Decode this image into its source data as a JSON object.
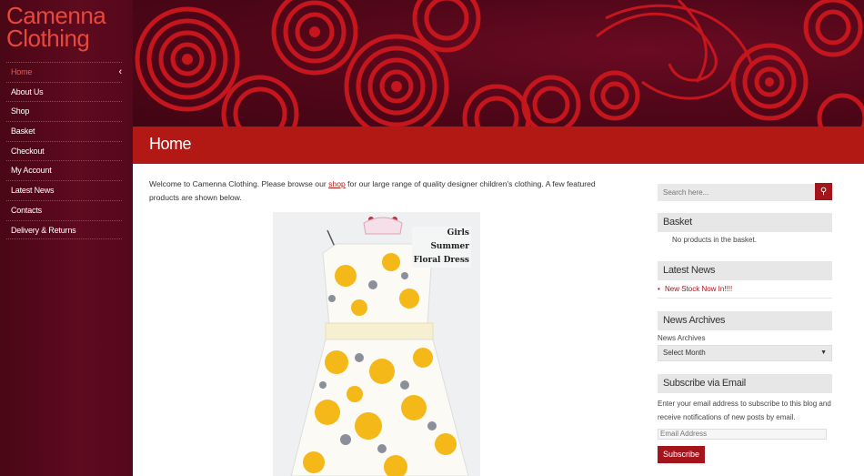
{
  "site": {
    "logo_line1": "Camenna",
    "logo_line2": "Clothing"
  },
  "nav": [
    {
      "label": "Home"
    },
    {
      "label": "About Us"
    },
    {
      "label": "Shop"
    },
    {
      "label": "Basket"
    },
    {
      "label": "Checkout"
    },
    {
      "label": "My Account"
    },
    {
      "label": "Latest News"
    },
    {
      "label": "Contacts"
    },
    {
      "label": "Delivery & Returns"
    }
  ],
  "page": {
    "title": "Home",
    "intro_before": "Welcome to Camenna Clothing. Please browse our ",
    "intro_link": "shop",
    "intro_after": " for our large range of quality designer children's clothing. A few featured products are shown below.",
    "product_label": [
      "Girls",
      "Summer",
      "Floral Dress"
    ]
  },
  "sidebar": {
    "search_placeholder": "Search here...",
    "basket_title": "Basket",
    "basket_text": "No products in the basket.",
    "news_title": "Latest News",
    "news_item": "New Stock Now In!!!!",
    "archives_title": "News Archives",
    "archives_label": "News Archives",
    "archives_select": "Select Month",
    "subscribe_title": "Subscribe via Email",
    "subscribe_text": "Enter your email address to subscribe to this blog and receive notifications of new posts by email.",
    "email_placeholder": "Email Address",
    "subscribe_button": "Subscribe"
  },
  "colors": {
    "accent": "#b31914",
    "sidebar_bg": "#5e0a1f",
    "logo": "#e8483c"
  }
}
